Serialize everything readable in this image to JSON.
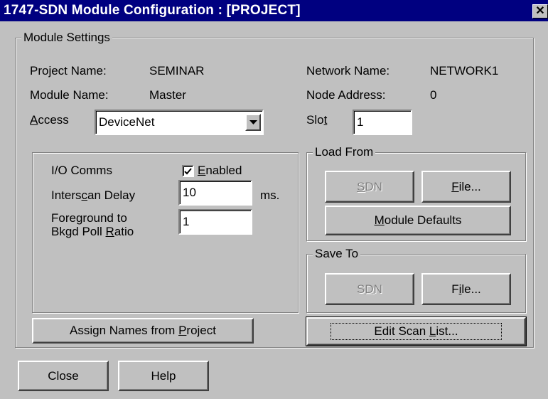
{
  "window": {
    "title": "1747-SDN Module Configuration : [PROJECT]",
    "close_glyph": "✕"
  },
  "module_settings": {
    "group_label": "Module Settings",
    "project_name_label": "Project Name:",
    "project_name_value": "SEMINAR",
    "module_name_label": "Module Name:",
    "module_name_value": "Master",
    "access_label_pre": "",
    "access_label_u": "A",
    "access_label_post": "ccess",
    "access_value": "DeviceNet",
    "network_name_label": "Network Name:",
    "network_name_value": "NETWORK1",
    "node_address_label": "Node Address:",
    "node_address_value": "0",
    "slot_label_pre": "Slo",
    "slot_label_u": "t",
    "slot_value": "1"
  },
  "io_comms": {
    "label": "I/O Comms",
    "enabled_u": "E",
    "enabled_rest": "nabled",
    "enabled_checked": true,
    "interscan_pre": "Inters",
    "interscan_u": "c",
    "interscan_post": "an Delay",
    "interscan_value": "10",
    "interscan_unit": "ms.",
    "fg_line1": "Foreground to",
    "fg_line2_pre": "Bkgd Poll ",
    "fg_line2_u": "R",
    "fg_line2_post": "atio",
    "fg_value": "1"
  },
  "load_from": {
    "group_label": "Load From",
    "sdn_u": "S",
    "sdn_rest": "DN",
    "file_u": "F",
    "file_rest": "ile...",
    "defaults_u": "M",
    "defaults_rest": "odule Defaults"
  },
  "save_to": {
    "group_label": "Save To",
    "sdn_pre": "S",
    "sdn_u": "D",
    "sdn_post": "N",
    "file_pre": "F",
    "file_u": "i",
    "file_post": "le..."
  },
  "buttons": {
    "assign_pre": "Assign Names from ",
    "assign_u": "P",
    "assign_post": "roject",
    "edit_pre": "Edit Scan ",
    "edit_u": "L",
    "edit_post": "ist...",
    "close": "Close",
    "help": "Help"
  },
  "colors": {
    "titlebar": "#000080",
    "face": "#c0c0c0",
    "disabled_text": "#808080"
  },
  "icons": {
    "check": "checkmark-icon",
    "dropdown": "triangle-down-icon",
    "close": "close-icon"
  }
}
